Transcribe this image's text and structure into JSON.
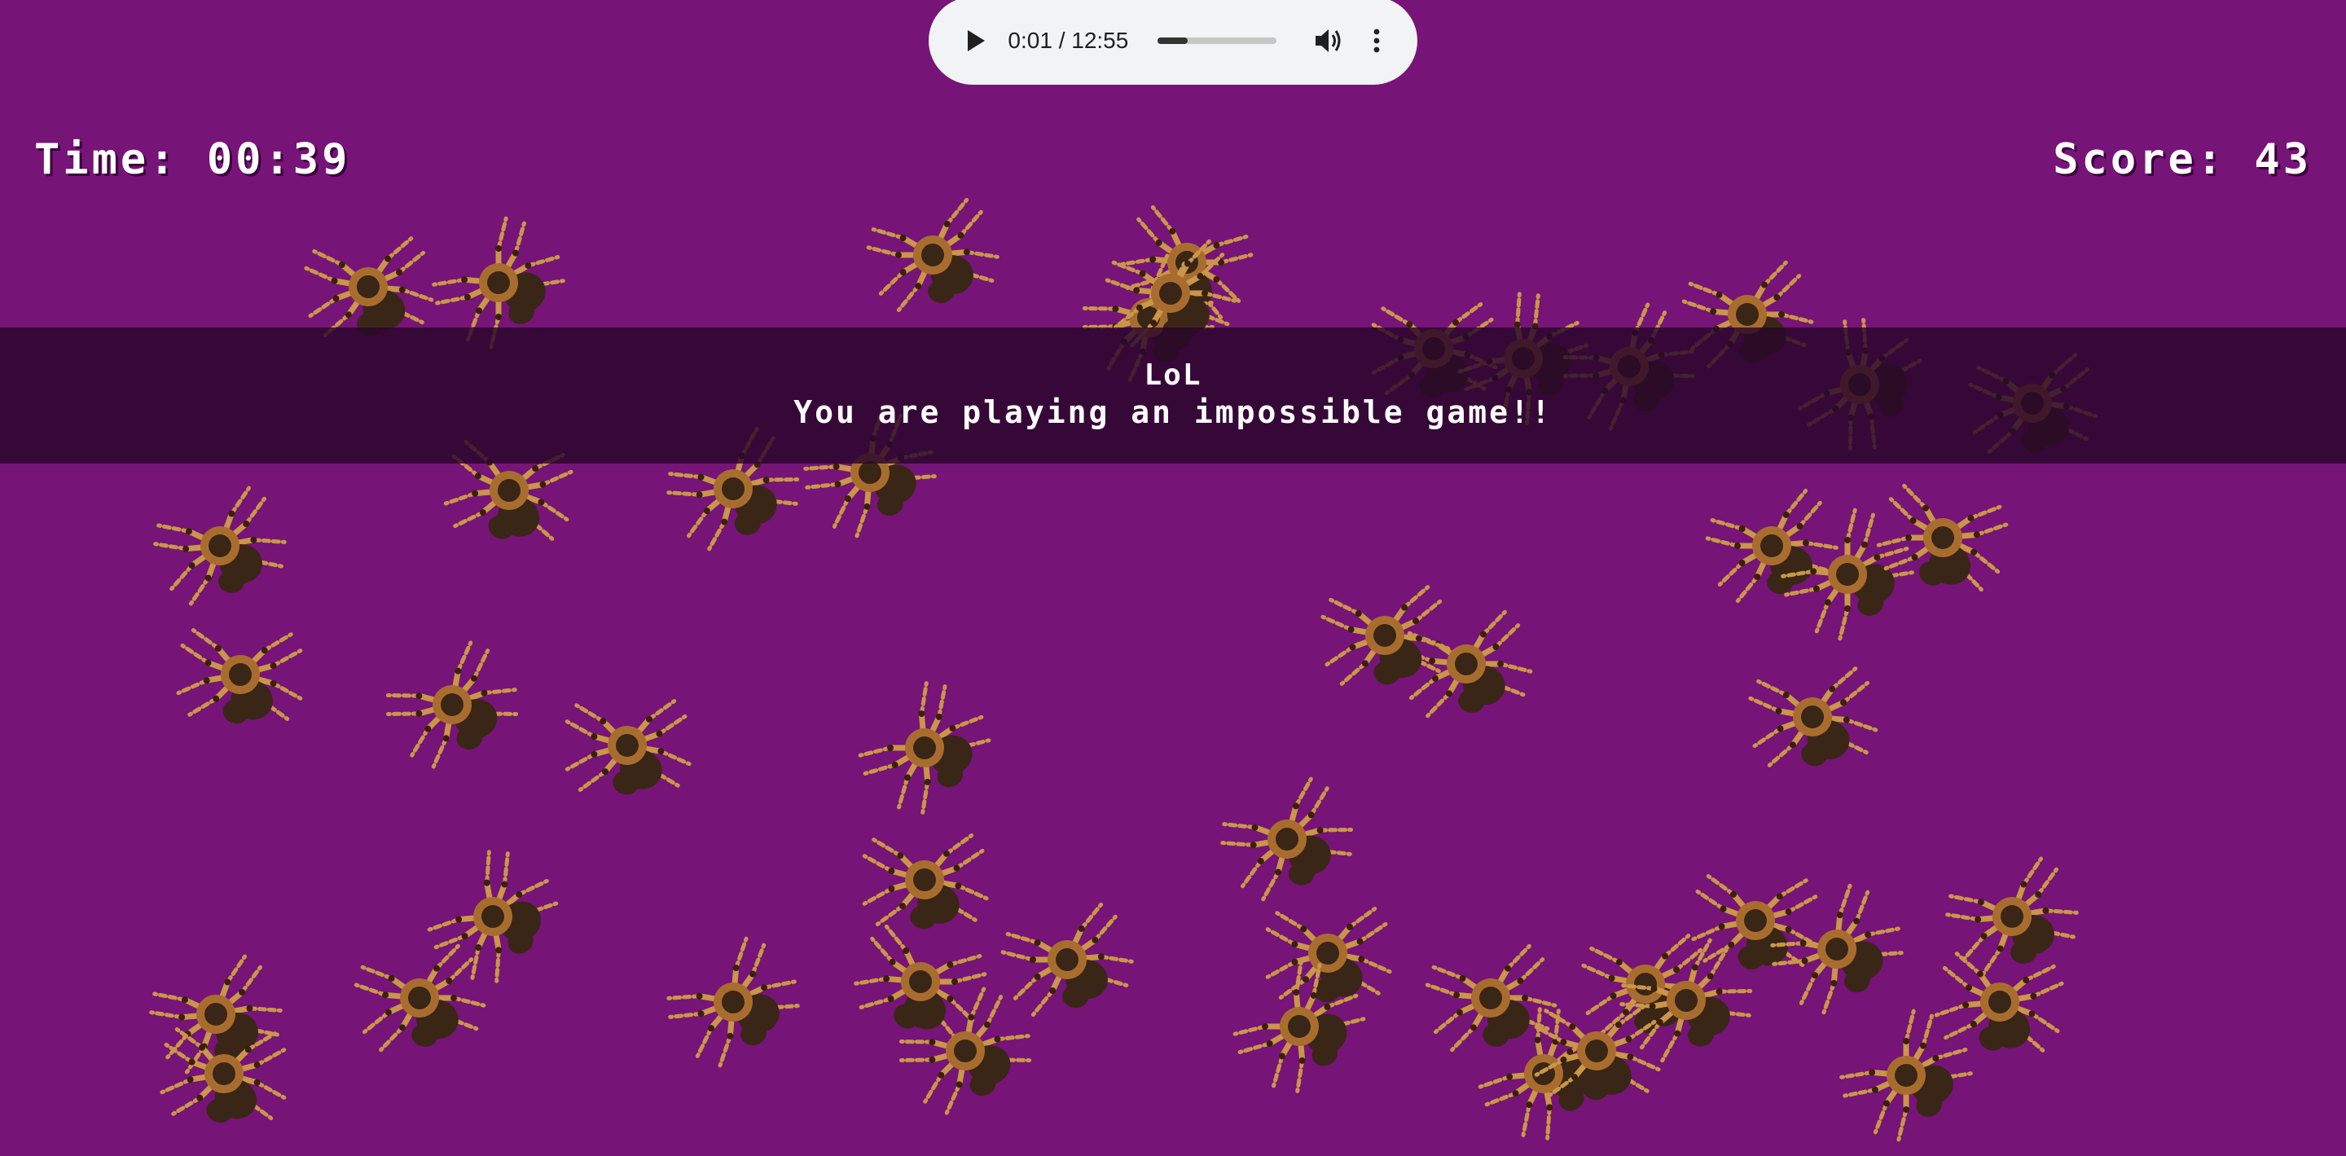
{
  "audio": {
    "time_display": "0:01 / 12:55",
    "progress_fraction": 0.25,
    "play_icon": "play-icon",
    "volume_icon": "volume-icon",
    "more_icon": "more-vertical-icon"
  },
  "hud": {
    "time_text": "Time: 00:39",
    "score_text": "Score: 43"
  },
  "banner": {
    "title": "LoL",
    "message": "You are playing an impossible game!!"
  },
  "game": {
    "spider_count": 48,
    "colors": {
      "background": "#761478",
      "banner_bg": "#28062a",
      "spider_leg": "#c9964a",
      "spider_leg_dark": "#3a2008",
      "spider_body": "#3a2616",
      "spider_body_light": "#a86d2e"
    }
  }
}
